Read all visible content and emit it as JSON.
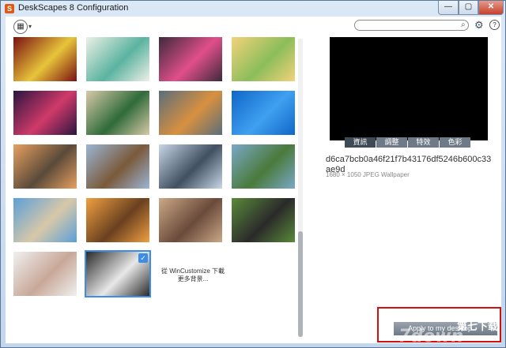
{
  "window": {
    "title": "DeskScapes 8 Configuration",
    "app_icon": "S",
    "controls": {
      "min": "—",
      "max": "▢",
      "close": "✕"
    }
  },
  "toolbar": {
    "view_icon": "view-menu-icon",
    "caret": "▾",
    "search_placeholder": "",
    "search_glyph": "⌕",
    "gear_glyph": "⚙",
    "help_glyph": "?"
  },
  "gallery": {
    "thumbnails": [
      {
        "style": "red-yellow-circles",
        "colors": [
          "#7a1010",
          "#e8c43a"
        ]
      },
      {
        "style": "pastel-abstract",
        "colors": [
          "#eef0e6",
          "#5ab3a0"
        ]
      },
      {
        "style": "colorful-swirl",
        "colors": [
          "#3d2a3a",
          "#e04f8a"
        ]
      },
      {
        "style": "dotted-landscape",
        "colors": [
          "#f3d27b",
          "#8bbd5a"
        ]
      },
      {
        "style": "purple-red-dots",
        "colors": [
          "#2a1540",
          "#d03a6a"
        ]
      },
      {
        "style": "green-flowers",
        "colors": [
          "#d8c9a8",
          "#2f6b3a"
        ]
      },
      {
        "style": "color-patchwork",
        "colors": [
          "#5a6e7a",
          "#d89040"
        ]
      },
      {
        "style": "windows-7",
        "colors": [
          "#0f66c8",
          "#3fa0f0"
        ]
      },
      {
        "style": "karst-sunset",
        "colors": [
          "#e8a060",
          "#5a4a3a"
        ]
      },
      {
        "style": "great-wall",
        "colors": [
          "#9bb5d6",
          "#7a5a3a"
        ]
      },
      {
        "style": "misty-mountains",
        "colors": [
          "#c8d6e6",
          "#405060"
        ]
      },
      {
        "style": "rice-terraces",
        "colors": [
          "#7aa8c8",
          "#4a7a3a"
        ]
      },
      {
        "style": "beach-rocks",
        "colors": [
          "#5aa0d8",
          "#d8c8a8"
        ]
      },
      {
        "style": "stone-bridge",
        "colors": [
          "#f0a040",
          "#6a4020"
        ]
      },
      {
        "style": "woman-portrait",
        "colors": [
          "#caa888",
          "#6a4a3a"
        ]
      },
      {
        "style": "man-portrait",
        "colors": [
          "#5a8a3a",
          "#2a2a2a"
        ]
      },
      {
        "style": "woman-white",
        "colors": [
          "#f0f0f0",
          "#c8a898"
        ]
      },
      {
        "style": "woman-hair",
        "colors": [
          "#2a2a2a",
          "#e8e8e8"
        ]
      }
    ],
    "selected_index": 17,
    "check_glyph": "✓",
    "more_text": "從 WinCustomize 下載更多背景..."
  },
  "panel": {
    "tabs": [
      "資訊",
      "調整",
      "特效",
      "色彩"
    ],
    "active_tab": 0,
    "hash": "d6ca7bcb0a46f21f7b43176df5246b600c33ae9d",
    "info": "1680 × 1050 JPEG Wallpaper",
    "apply_label": "Apply to my desktop"
  },
  "watermark": {
    "site": "第七下载",
    "domain": "7down"
  }
}
